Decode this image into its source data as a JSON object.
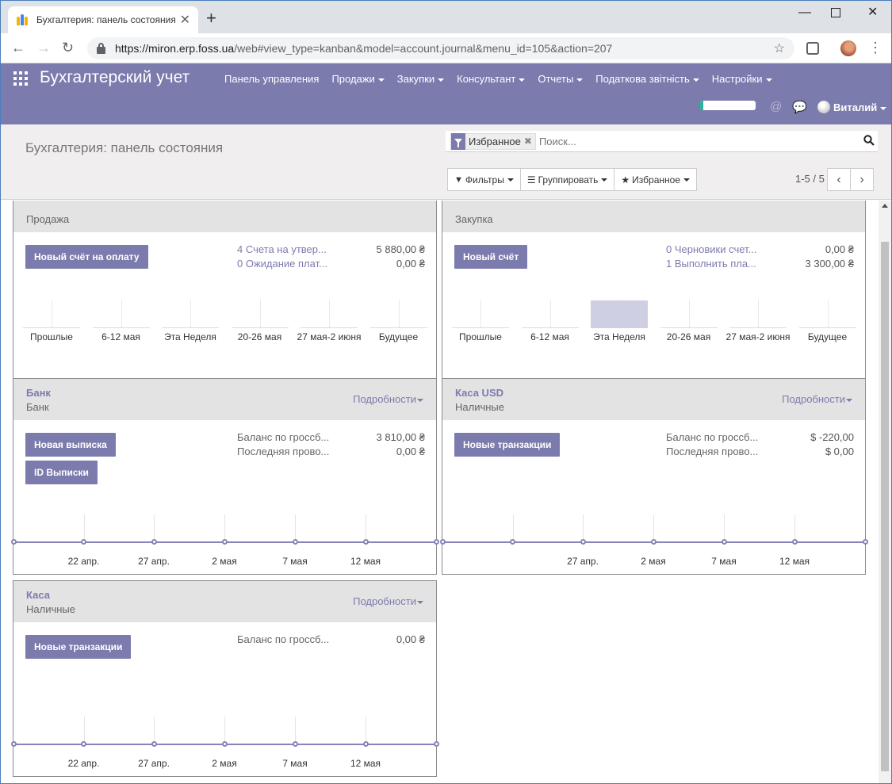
{
  "browser": {
    "tab_title": "Бухгалтерия: панель состояния",
    "url_host": "https://miron.erp.foss.ua",
    "url_path": "/web#view_type=kanban&model=account.journal&menu_id=105&action=207"
  },
  "navbar": {
    "brand": "Бухгалтерский учет",
    "menu": [
      "Панель управления",
      "Продажи",
      "Закупки",
      "Консультант",
      "Отчеты",
      "Податкова звітність",
      "Настройки"
    ],
    "menu_has_caret": [
      false,
      true,
      true,
      true,
      true,
      true,
      true
    ],
    "progress": 0.06,
    "user": "Виталий"
  },
  "control": {
    "title": "Бухгалтерия: панель состояния",
    "facet": "Избранное",
    "search_placeholder": "Поиск...",
    "filters": "Фильтры",
    "group": "Группировать",
    "favorites": "Избранное",
    "pager": "1-5 / 5"
  },
  "cards": [
    {
      "name": "",
      "type": "Продажа",
      "buttons": [
        "Новый счёт на оплату"
      ],
      "stats": [
        {
          "label": "4 Счета на утвер...",
          "value": "5 880,00 ₴",
          "link": true
        },
        {
          "label": "0 Ожидание плат...",
          "value": "0,00 ₴",
          "link": true
        }
      ],
      "chart": {
        "type": "bar",
        "categories": [
          "Прошлые",
          "6-12 мая",
          "Эта Неделя",
          "20-26 мая",
          "27 мая-2 июня",
          "Будущее"
        ],
        "values": [
          0,
          0,
          0,
          0,
          0,
          0
        ]
      }
    },
    {
      "name": "",
      "type": "Закупка",
      "buttons": [
        "Новый счёт"
      ],
      "stats": [
        {
          "label": "0 Черновики счет...",
          "value": "0,00 ₴",
          "link": true
        },
        {
          "label": "1 Выполнить пла...",
          "value": "3 300,00 ₴",
          "link": true
        }
      ],
      "chart": {
        "type": "bar",
        "categories": [
          "Прошлые",
          "6-12 мая",
          "Эта Неделя",
          "20-26 мая",
          "27 мая-2 июня",
          "Будущее"
        ],
        "values": [
          0,
          0,
          3300,
          0,
          0,
          0
        ]
      }
    },
    {
      "name": "Банк",
      "type": "Банк",
      "more": "Подробности",
      "buttons": [
        "Новая выписка",
        "ID Выписки"
      ],
      "stats": [
        {
          "label": "Баланс по гроссб...",
          "value": "3 810,00 ₴",
          "link": false
        },
        {
          "label": "Последняя прово...",
          "value": "0,00 ₴",
          "link": false
        }
      ],
      "chart": {
        "type": "line",
        "labels": [
          "22 апр.",
          "27 апр.",
          "2 мая",
          "7 мая",
          "12 мая"
        ]
      }
    },
    {
      "name": "Каса USD",
      "type": "Наличные",
      "more": "Подробности",
      "buttons": [
        "Новые транзакции"
      ],
      "stats": [
        {
          "label": "Баланс по гроссб...",
          "value": "$ -220,00",
          "link": false
        },
        {
          "label": "Последняя прово...",
          "value": "$ 0,00",
          "link": false
        }
      ],
      "chart": {
        "type": "line",
        "labels": [
          "27 апр.",
          "2 мая",
          "7 мая",
          "12 мая"
        ]
      }
    },
    {
      "name": "Каса",
      "type": "Наличные",
      "more": "Подробности",
      "buttons": [
        "Новые транзакции"
      ],
      "stats": [
        {
          "label": "Баланс по гроссб...",
          "value": "0,00 ₴",
          "link": false
        }
      ],
      "chart": {
        "type": "line",
        "labels": [
          "22 апр.",
          "27 апр.",
          "2 мая",
          "7 мая",
          "12 мая"
        ]
      }
    }
  ]
}
